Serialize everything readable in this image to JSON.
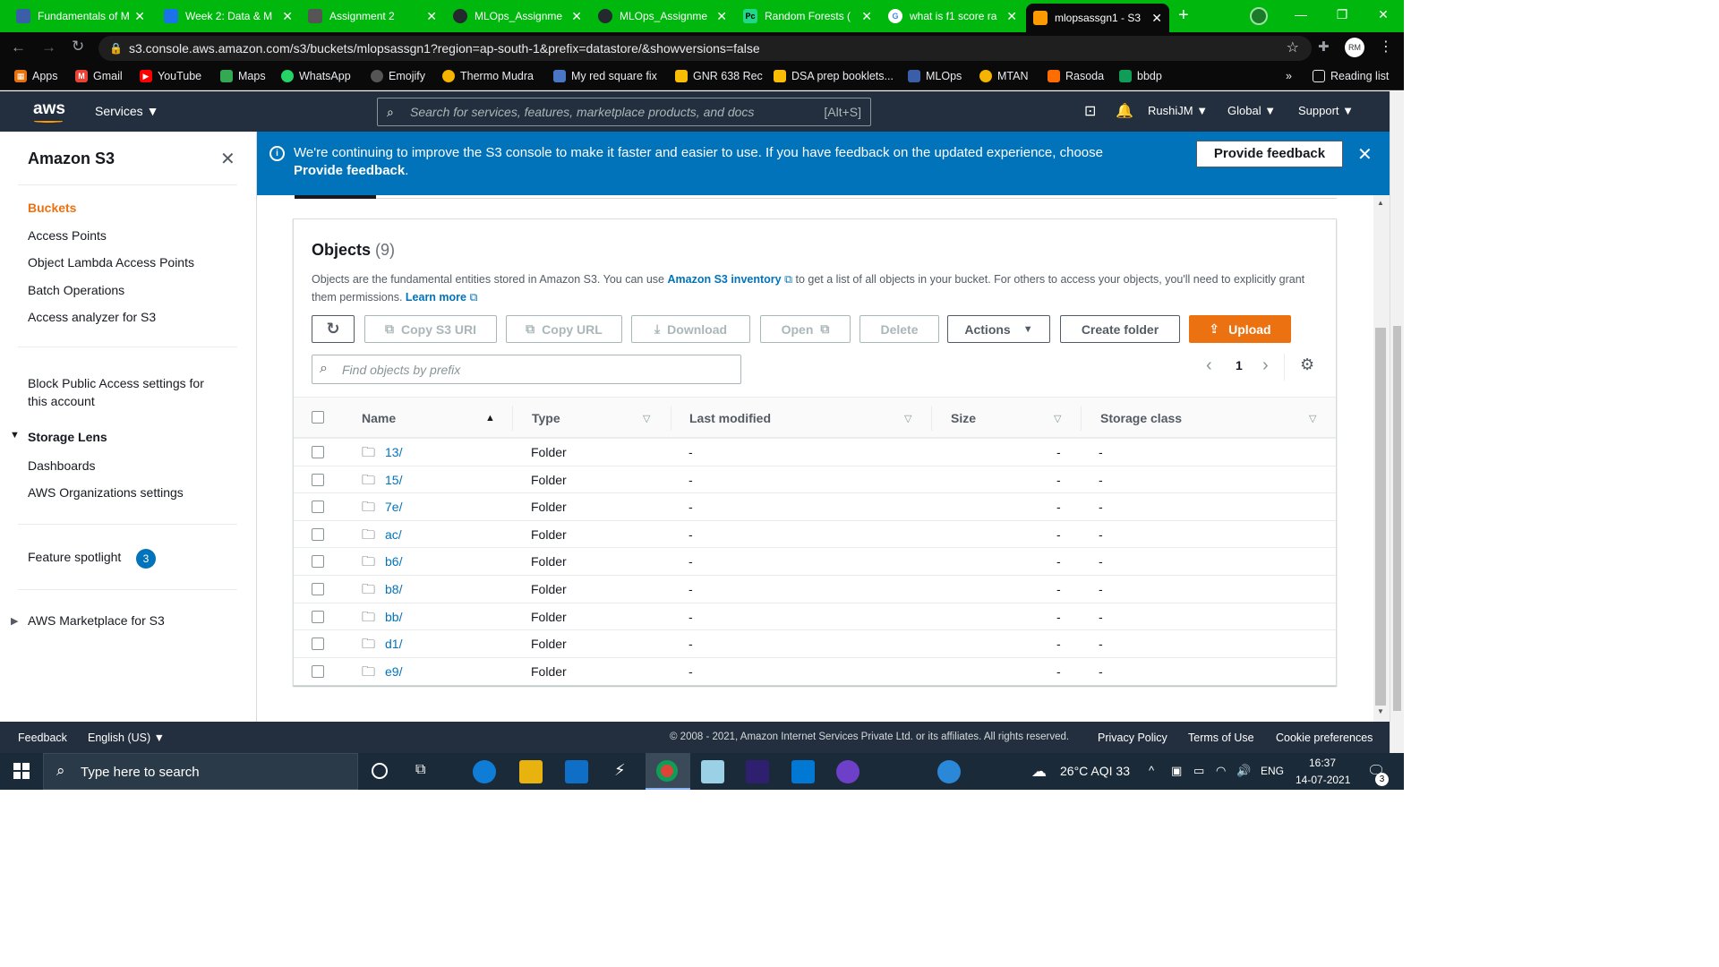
{
  "browser": {
    "tabs": [
      {
        "title": "Fundamentals of M",
        "icon_color": "#3b5ea8"
      },
      {
        "title": "Week 2: Data & M",
        "icon_color": "#1a73e8"
      },
      {
        "title": "Assignment 2",
        "icon_color": "#555555"
      },
      {
        "title": "MLOps_Assignme",
        "icon_color": "#24292e"
      },
      {
        "title": "MLOps_Assignme",
        "icon_color": "#24292e"
      },
      {
        "title": "Random Forests (",
        "icon_color": "#21d789"
      },
      {
        "title": "what is f1 score ra",
        "icon_color": "#4285f4"
      },
      {
        "title": "mlopsassgn1 - S3",
        "icon_color": "#ff9900"
      }
    ],
    "url": "s3.console.aws.amazon.com/s3/buckets/mlopsassgn1?region=ap-south-1&prefix=datastore/&showversions=false",
    "profile_initials": "RM",
    "bookmarks": [
      {
        "label": "Apps",
        "icon_color": "#e8710a"
      },
      {
        "label": "Gmail",
        "icon_color": "#ea4335"
      },
      {
        "label": "YouTube",
        "icon_color": "#ff0000"
      },
      {
        "label": "Maps",
        "icon_color": "#34a853"
      },
      {
        "label": "WhatsApp",
        "icon_color": "#25d366"
      },
      {
        "label": "Emojify",
        "icon_color": "#24292e"
      },
      {
        "label": "Thermo Mudra",
        "icon_color": "#f4b400"
      },
      {
        "label": "My red square fix",
        "icon_color": "#4a76c6"
      },
      {
        "label": "GNR 638 Rec",
        "icon_color": "#fbbc04"
      },
      {
        "label": "DSA prep booklets...",
        "icon_color": "#fbbc04"
      },
      {
        "label": "MLOps",
        "icon_color": "#3b5ea8"
      },
      {
        "label": "MTAN",
        "icon_color": "#f4b400"
      },
      {
        "label": "Rasoda",
        "icon_color": "#ff6d00"
      },
      {
        "label": "bbdp",
        "icon_color": "#0f9d58"
      }
    ],
    "reading_list": "Reading list",
    "more": "»"
  },
  "aws_header": {
    "logo": "aws",
    "services": "Services",
    "search_placeholder": "Search for services, features, marketplace products, and docs",
    "search_shortcut": "[Alt+S]",
    "user": "RushiJM",
    "region": "Global",
    "support": "Support"
  },
  "sidebar": {
    "title": "Amazon S3",
    "items": [
      "Buckets",
      "Access Points",
      "Object Lambda Access Points",
      "Batch Operations",
      "Access analyzer for S3"
    ],
    "block_public": "Block Public Access settings for this account",
    "storage_lens": "Storage Lens",
    "storage_lens_items": [
      "Dashboards",
      "AWS Organizations settings"
    ],
    "feature_spotlight": "Feature spotlight",
    "feature_count": "3",
    "marketplace": "AWS Marketplace for S3"
  },
  "banner": {
    "text": "We're continuing to improve the S3 console to make it faster and easier to use. If you have feedback on the updated experience, choose ",
    "bold": "Provide feedback",
    "suffix": ".",
    "button": "Provide feedback"
  },
  "objects": {
    "title": "Objects",
    "count": "(9)",
    "desc1": "Objects are the fundamental entities stored in Amazon S3. You can use ",
    "inventory_link": "Amazon S3 inventory",
    "desc2": " to get a list of all objects in your bucket. For others to access your objects, you'll need to explicitly grant them permissions. ",
    "learn_more": "Learn more",
    "buttons": {
      "copy_uri": "Copy S3 URI",
      "copy_url": "Copy URL",
      "download": "Download",
      "open": "Open",
      "delete": "Delete",
      "actions": "Actions",
      "create_folder": "Create folder",
      "upload": "Upload"
    },
    "find_placeholder": "Find objects by prefix",
    "page": "1",
    "columns": [
      "Name",
      "Type",
      "Last modified",
      "Size",
      "Storage class"
    ],
    "rows": [
      {
        "name": "13/",
        "type": "Folder",
        "modified": "-",
        "size": "-",
        "storage": "-"
      },
      {
        "name": "15/",
        "type": "Folder",
        "modified": "-",
        "size": "-",
        "storage": "-"
      },
      {
        "name": "7e/",
        "type": "Folder",
        "modified": "-",
        "size": "-",
        "storage": "-"
      },
      {
        "name": "ac/",
        "type": "Folder",
        "modified": "-",
        "size": "-",
        "storage": "-"
      },
      {
        "name": "b6/",
        "type": "Folder",
        "modified": "-",
        "size": "-",
        "storage": "-"
      },
      {
        "name": "b8/",
        "type": "Folder",
        "modified": "-",
        "size": "-",
        "storage": "-"
      },
      {
        "name": "bb/",
        "type": "Folder",
        "modified": "-",
        "size": "-",
        "storage": "-"
      },
      {
        "name": "d1/",
        "type": "Folder",
        "modified": "-",
        "size": "-",
        "storage": "-"
      },
      {
        "name": "e9/",
        "type": "Folder",
        "modified": "-",
        "size": "-",
        "storage": "-"
      }
    ]
  },
  "footer": {
    "feedback": "Feedback",
    "language": "English (US)",
    "copyright": "© 2008 - 2021, Amazon Internet Services Private Ltd. or its affiliates. All rights reserved.",
    "privacy": "Privacy Policy",
    "terms": "Terms of Use",
    "cookies": "Cookie preferences"
  },
  "taskbar": {
    "search_placeholder": "Type here to search",
    "weather": "26°C  AQI 33",
    "lang": "ENG",
    "time": "16:37",
    "date": "14-07-2021",
    "notifications": "3"
  },
  "colors": {
    "tab_bar": "#00b80d",
    "aws_nav": "#232f3e",
    "banner": "#0073bb",
    "upload": "#ec7211",
    "active_nav": "#ec7211",
    "link": "#0073bb"
  }
}
